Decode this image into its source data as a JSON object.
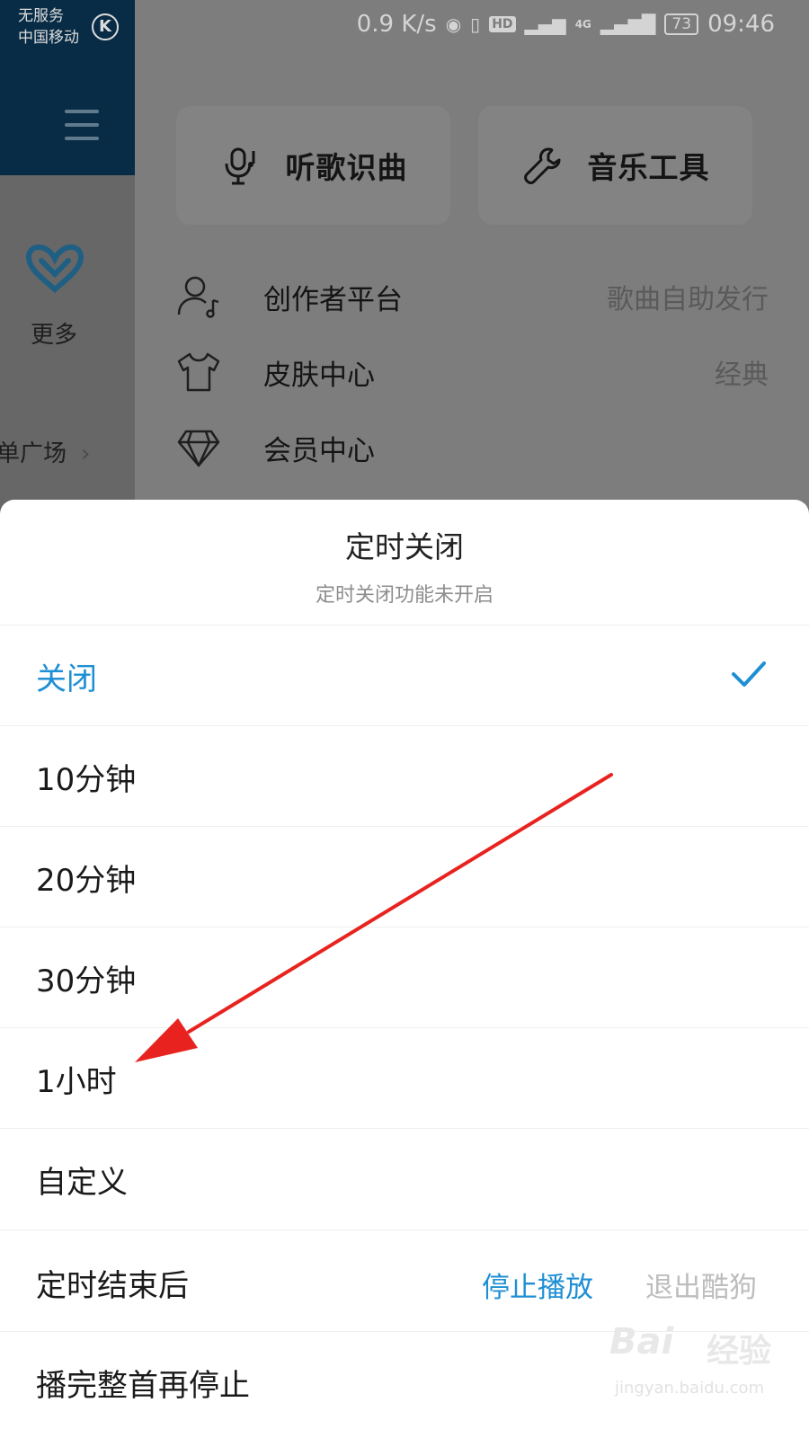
{
  "status_bar": {
    "carrier_line1": "无服务",
    "carrier_line2": "中国移动",
    "carrier_badge": "K",
    "net_speed": "0.9 K/s",
    "hd_badge": "HD",
    "network_type": "4G",
    "battery": "73",
    "time": "09:46"
  },
  "left_rail": {
    "more_label": "更多",
    "plaza_label": "单广场",
    "plaza_chevron": "›"
  },
  "tools": {
    "recognize_label": "听歌识曲",
    "music_tools_label": "音乐工具"
  },
  "menu": [
    {
      "label": "创作者平台",
      "sub": "歌曲自助发行",
      "icon": "creator-icon"
    },
    {
      "label": "皮肤中心",
      "sub": "经典",
      "icon": "tshirt-icon"
    },
    {
      "label": "会员中心",
      "sub": "",
      "icon": "diamond-icon"
    }
  ],
  "sheet": {
    "title": "定时关闭",
    "subtitle": "定时关闭功能未开启",
    "options": [
      {
        "label": "关闭",
        "selected": true
      },
      {
        "label": "10分钟",
        "selected": false
      },
      {
        "label": "20分钟",
        "selected": false
      },
      {
        "label": "30分钟",
        "selected": false
      },
      {
        "label": "1小时",
        "selected": false
      },
      {
        "label": "自定义",
        "selected": false
      }
    ],
    "after_label": "定时结束后",
    "after_stop": "停止播放",
    "after_exit": "退出酷狗",
    "finish_label": "播完整首再停止"
  },
  "watermark": {
    "logo": "Bai",
    "suffix": "经验",
    "url": "jingyan.baidu.com"
  },
  "colors": {
    "accent": "#1e8fd4",
    "arrow": "#e8231f",
    "overlay": "#7d7d7d"
  }
}
